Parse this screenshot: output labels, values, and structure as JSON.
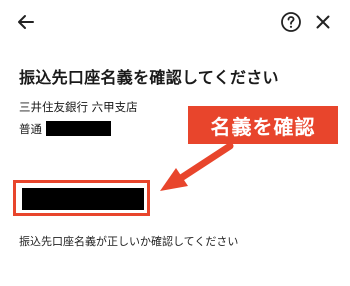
{
  "header": {
    "back_icon": "arrow-left-icon",
    "help_icon": "question-circle-icon",
    "close_icon": "close-icon"
  },
  "page": {
    "title": "振込先口座名義を確認してください",
    "bank_branch": "三井住友銀行 六甲支店",
    "account_type": "普通",
    "helper_text": "振込先口座名義が正しいか確認してください"
  },
  "annotation": {
    "callout_label": "名義を確認",
    "accent_color": "#e8452c"
  }
}
